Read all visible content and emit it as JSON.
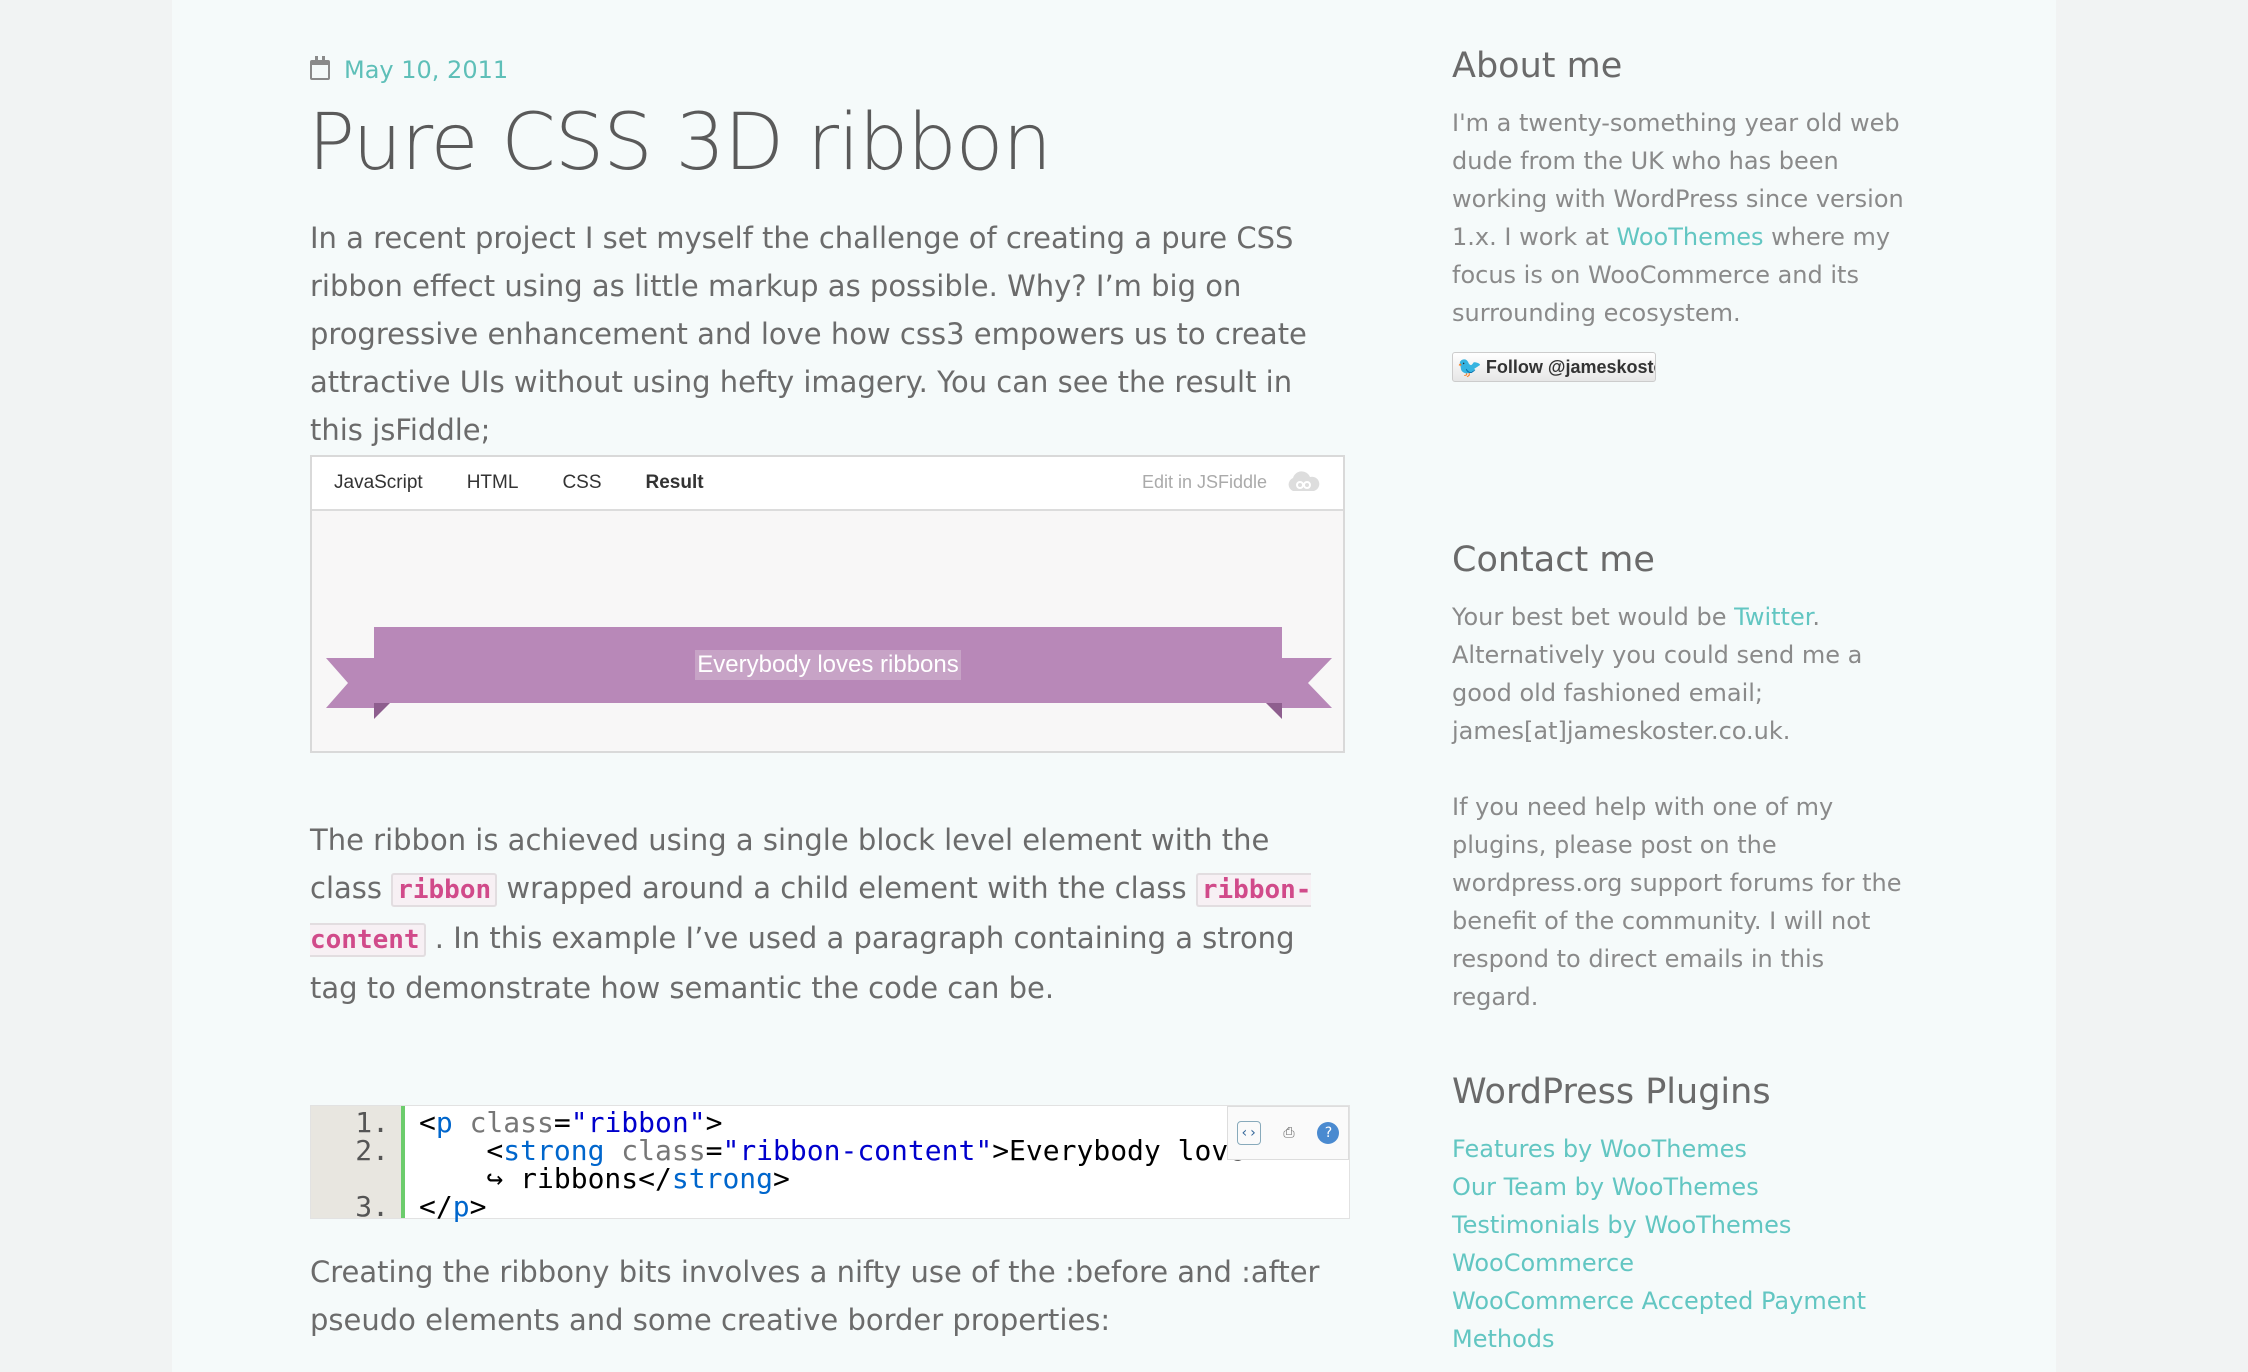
{
  "post": {
    "date": "May 10, 2011",
    "title": "Pure CSS 3D ribbon",
    "para1": "In a recent project I set myself the challenge of creating a pure CSS ribbon effect using as little markup as possible. Why? I’m big on progressive enhancement and love how css3 empowers us to create attractive UIs without using hefty imagery. You can see the result in this jsFiddle;",
    "para2_a": "The ribbon is achieved using a single block level element with the class ",
    "para2_code1": "ribbon",
    "para2_b": " wrapped around a child element with the class ",
    "para2_code2": "ribbon-content",
    "para2_c": ". In this example I’ve used a paragraph containing a strong tag to demonstrate how semantic the code can be.",
    "para3": "Creating the ribbony bits involves a nifty use of the :before and :after pseudo elements and some creative border properties:"
  },
  "fiddle": {
    "tabs": [
      "JavaScript",
      "HTML",
      "CSS",
      "Result"
    ],
    "active_tab": "Result",
    "edit_label": "Edit in JSFiddle",
    "ribbon_text": "Everybody loves ribbons"
  },
  "code": {
    "line_numbers": [
      "1.",
      "2.",
      "3."
    ],
    "l1_open": "<",
    "l1_tag": "p",
    "l1_attr": " class",
    "l1_eq": "=",
    "l1_val": "\"ribbon\"",
    "l1_close": ">",
    "l2_open": "    <",
    "l2_tag": "strong",
    "l2_attr": " class",
    "l2_eq": "=",
    "l2_val": "\"ribbon-content\"",
    "l2_text": ">Everybody love",
    "l2b_text": "    ↪ ribbons</",
    "l2b_tag": "strong",
    "l2b_close": ">",
    "l3_open": "</",
    "l3_tag": "p",
    "l3_close": ">"
  },
  "sidebar": {
    "about_title": "About me",
    "about_pre": "I'm a twenty-something year old web dude from the UK who has been working with WordPress since version 1.x. I work at ",
    "about_link": "WooThemes",
    "about_post": " where my focus is on WooCommerce and its surrounding ecosystem.",
    "follow_label": "Follow @jameskoste",
    "contact_title": "Contact me",
    "contact_pre": "Your best bet would be ",
    "contact_link": "Twitter",
    "contact_post": ". Alternatively you could send me a good old fashioned email; james[at]jameskoster.co.uk.",
    "contact_help": "If you need help with one of my plugins, please post on the wordpress.org support forums for the benefit of the community. I will not respond to direct emails in this regard.",
    "plugins_title": "WordPress Plugins",
    "plugins": [
      "Features by WooThemes",
      "Our Team by WooThemes",
      "Testimonials by WooThemes",
      "WooCommerce",
      "WooCommerce Accepted Payment Methods"
    ]
  },
  "colors": {
    "accent": "#62c6c2",
    "ribbon": "#b888b8",
    "ribbon_fold": "#9a6a9a",
    "inline_code": "#d14a8a"
  }
}
